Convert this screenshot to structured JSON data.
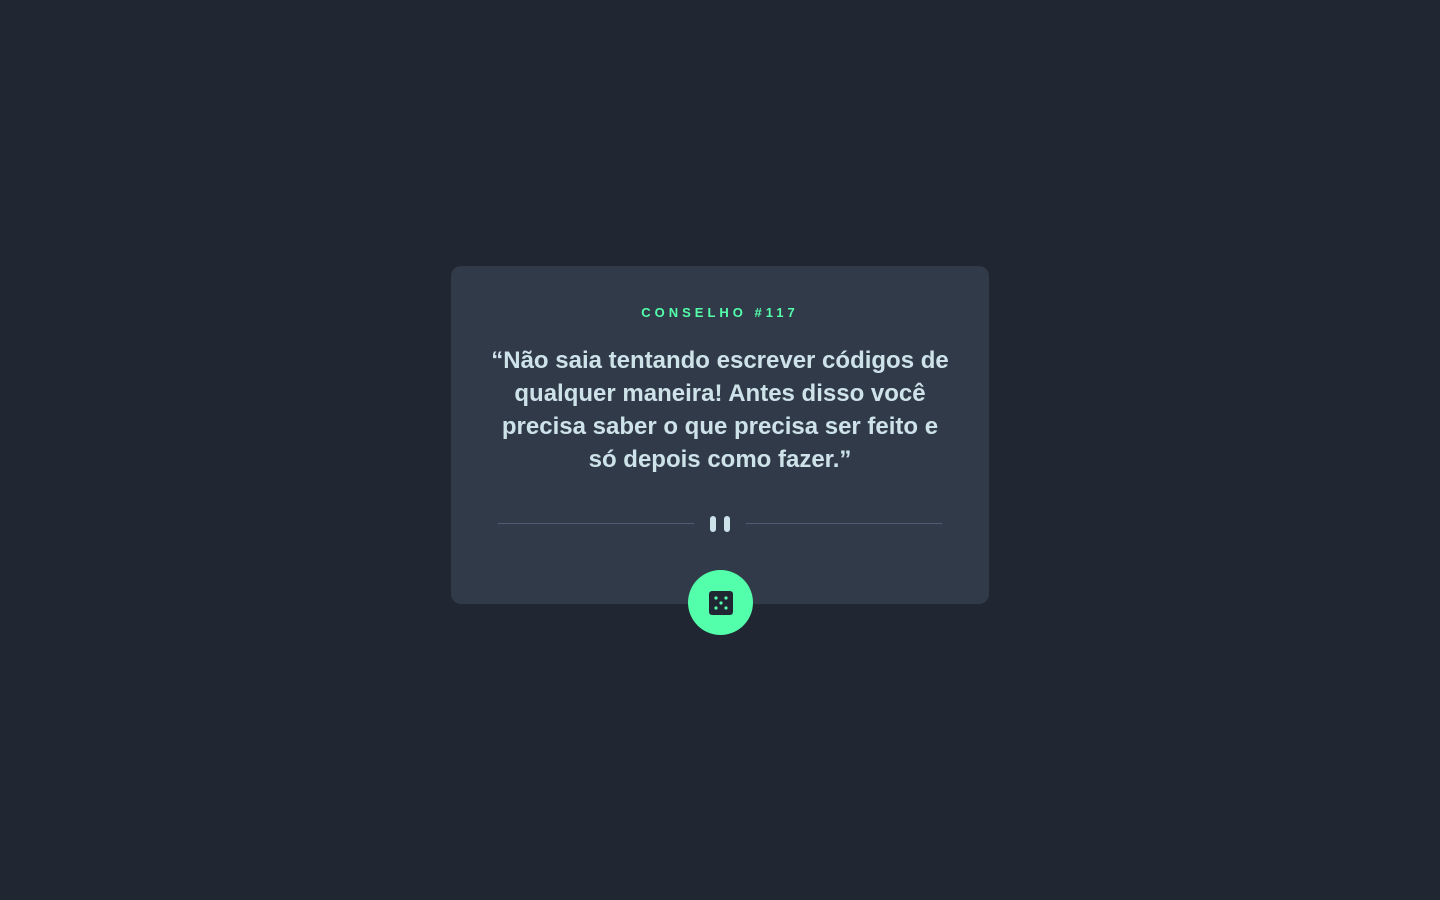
{
  "advice": {
    "label": "CONSELHO #117",
    "quote": "“Não saia tentando escrever códigos de qualquer maneira! Antes disso você precisa saber o que precisa ser feito e só depois como fazer.”"
  },
  "icons": {
    "divider": "pause-icon",
    "button": "dice-icon"
  },
  "colors": {
    "background": "#202632",
    "card": "#313a49",
    "accent": "#53ffaa",
    "text": "#cee3e9",
    "divider": "#4f5d74"
  }
}
